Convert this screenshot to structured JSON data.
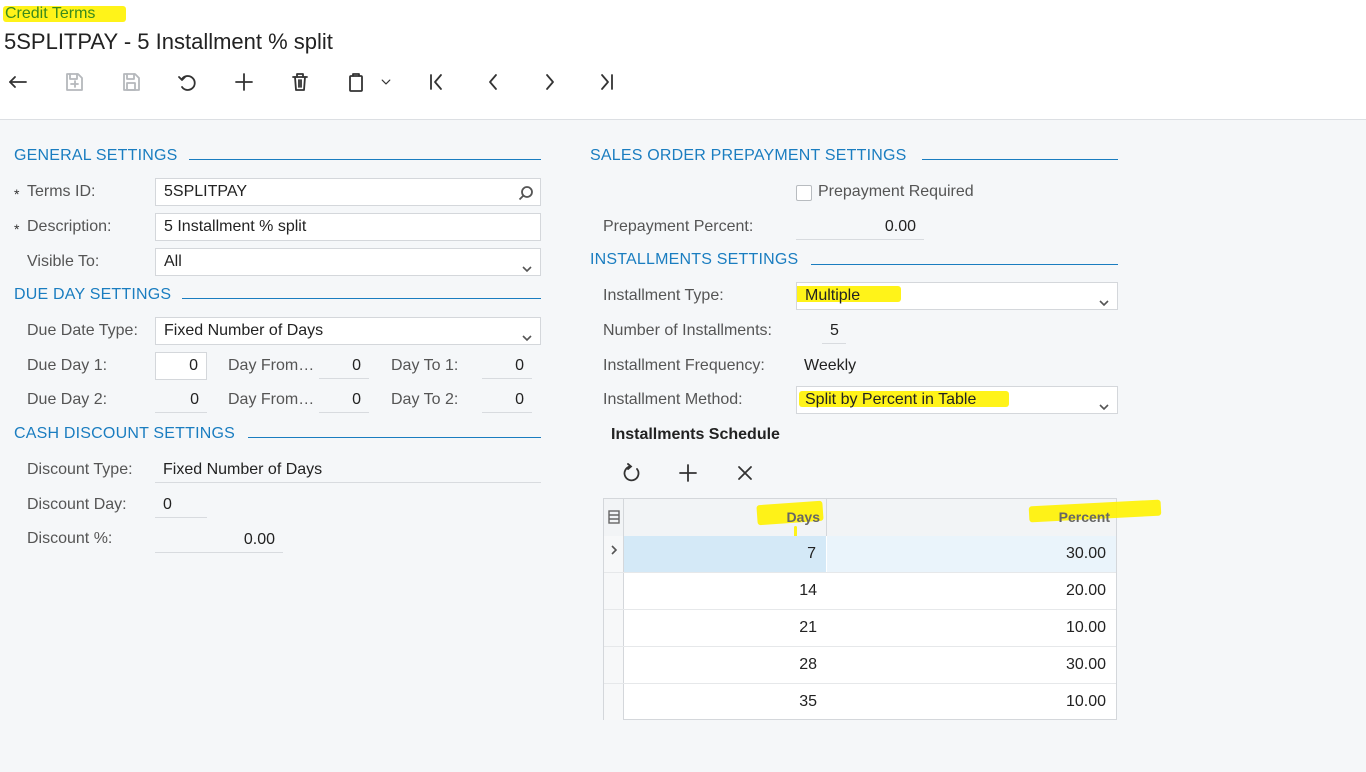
{
  "breadcrumb": "Credit Terms",
  "title": "5SPLITPAY - 5 Installment % split",
  "general": {
    "header": "GENERAL SETTINGS",
    "terms_id_label": "Terms ID:",
    "terms_id_value": "5SPLITPAY",
    "description_label": "Description:",
    "description_value": "5 Installment % split",
    "visible_to_label": "Visible To:",
    "visible_to_value": "All"
  },
  "due": {
    "header": "DUE DAY SETTINGS",
    "due_date_type_label": "Due Date Type:",
    "due_date_type_value": "Fixed Number of Days",
    "due_day1_label": "Due Day 1:",
    "due_day1_value": "0",
    "day_from1_label": "Day From…",
    "day_from1_value": "0",
    "day_to1_label": "Day To 1:",
    "day_to1_value": "0",
    "due_day2_label": "Due Day 2:",
    "due_day2_value": "0",
    "day_from2_label": "Day From…",
    "day_from2_value": "0",
    "day_to2_label": "Day To 2:",
    "day_to2_value": "0"
  },
  "cash": {
    "header": "CASH DISCOUNT SETTINGS",
    "discount_type_label": "Discount Type:",
    "discount_type_value": "Fixed Number of Days",
    "discount_day_label": "Discount Day:",
    "discount_day_value": "0",
    "discount_pct_label": "Discount %:",
    "discount_pct_value": "0.00"
  },
  "prepay": {
    "header": "SALES ORDER PREPAYMENT SETTINGS",
    "required_label": "Prepayment Required",
    "percent_label": "Prepayment Percent:",
    "percent_value": "0.00"
  },
  "install": {
    "header": "INSTALLMENTS SETTINGS",
    "type_label": "Installment Type:",
    "type_value": "Multiple",
    "number_label": "Number of Installments:",
    "number_value": "5",
    "frequency_label": "Installment Frequency:",
    "frequency_value": "Weekly",
    "method_label": "Installment Method:",
    "method_value": "Split by Percent in Table",
    "schedule_title": "Installments Schedule",
    "columns": [
      "Days",
      "Percent"
    ],
    "rows": [
      {
        "days": "7",
        "percent": "30.00"
      },
      {
        "days": "14",
        "percent": "20.00"
      },
      {
        "days": "21",
        "percent": "10.00"
      },
      {
        "days": "28",
        "percent": "30.00"
      },
      {
        "days": "35",
        "percent": "10.00"
      }
    ]
  },
  "colors": {
    "accent": "#1a7dc0",
    "highlight": "#fff200",
    "selected_row": "#d4e9f7",
    "breadcrumb": "#3a8b1c"
  }
}
